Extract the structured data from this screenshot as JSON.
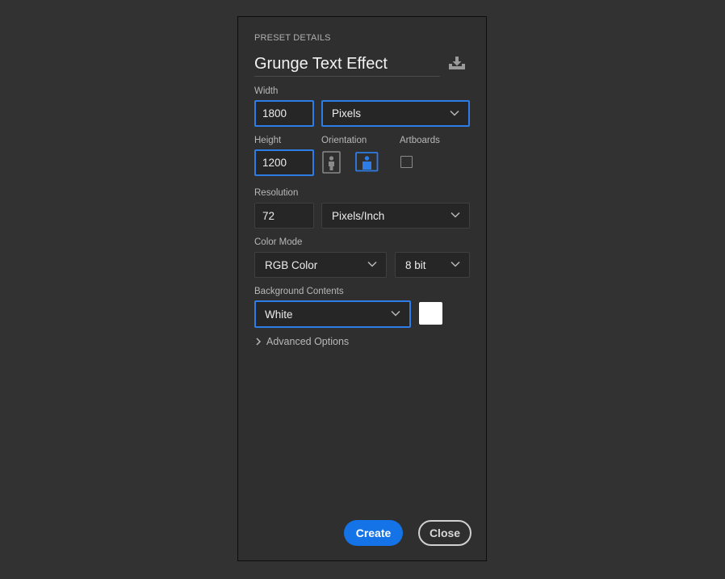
{
  "preset": {
    "section_title": "PRESET DETAILS",
    "name": "Grunge Text Effect",
    "save_icon": "save-preset-icon"
  },
  "width": {
    "label": "Width",
    "value": "1800",
    "unit": "Pixels"
  },
  "height": {
    "label": "Height",
    "value": "1200"
  },
  "orientation": {
    "label": "Orientation",
    "selected": "landscape"
  },
  "artboards": {
    "label": "Artboards",
    "checked": false
  },
  "resolution": {
    "label": "Resolution",
    "value": "72",
    "unit": "Pixels/Inch"
  },
  "color_mode": {
    "label": "Color Mode",
    "mode": "RGB Color",
    "depth": "8 bit"
  },
  "background": {
    "label": "Background Contents",
    "value": "White",
    "swatch_color": "#ffffff"
  },
  "advanced": {
    "label": "Advanced Options"
  },
  "buttons": {
    "create": "Create",
    "close": "Close"
  },
  "colors": {
    "accent": "#1473e6",
    "focus_border": "#2e7ce6",
    "panel_bg": "#2f2f2f",
    "page_bg": "#323232"
  }
}
